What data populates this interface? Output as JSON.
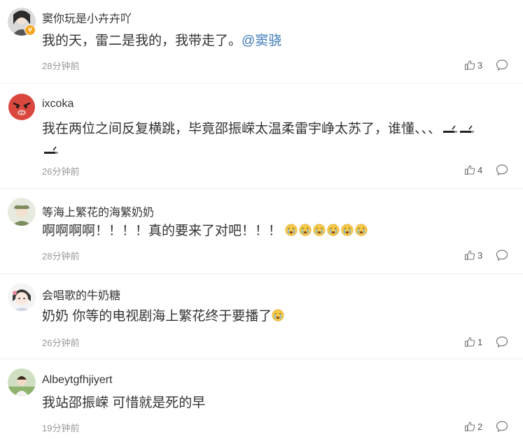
{
  "comments": [
    {
      "username": "窦你玩是小卉卉吖",
      "text": "我的天，雷二是我的，我带走了。",
      "mention": "@窦骁",
      "time": "28分钟前",
      "likes": "3",
      "verified": true
    },
    {
      "username": "ixcoka",
      "text": "我在两位之间反复横跳，毕竟邵振嵘太温柔雷宇峥太苏了，谁懂、、、",
      "time": "26分钟前",
      "likes": "4"
    },
    {
      "username": "等海上繁花的海繁奶奶",
      "text": "啊啊啊啊！！！！真的要来了对吧！！！",
      "time": "28分钟前",
      "likes": "3"
    },
    {
      "username": "会唱歌的牛奶糖",
      "text": "奶奶 你等的电视剧海上繁花终于要播了",
      "time": "26分钟前",
      "likes": "1"
    },
    {
      "username": "Albeytgfhjiyert",
      "text": "我站邵振嵘 可惜就是死的早",
      "time": "19分钟前",
      "likes": "2"
    }
  ],
  "icons": {
    "like": "thumbs-up-icon",
    "reply": "comment-bubble-icon",
    "crying_emoji": "crying-face-emoji",
    "verified": "verified-badge-icon"
  },
  "colors": {
    "username": "#333333",
    "mention": "#3d7ab8",
    "time": "#999999",
    "divider": "#eeeeee",
    "badge": "#f5a623"
  }
}
